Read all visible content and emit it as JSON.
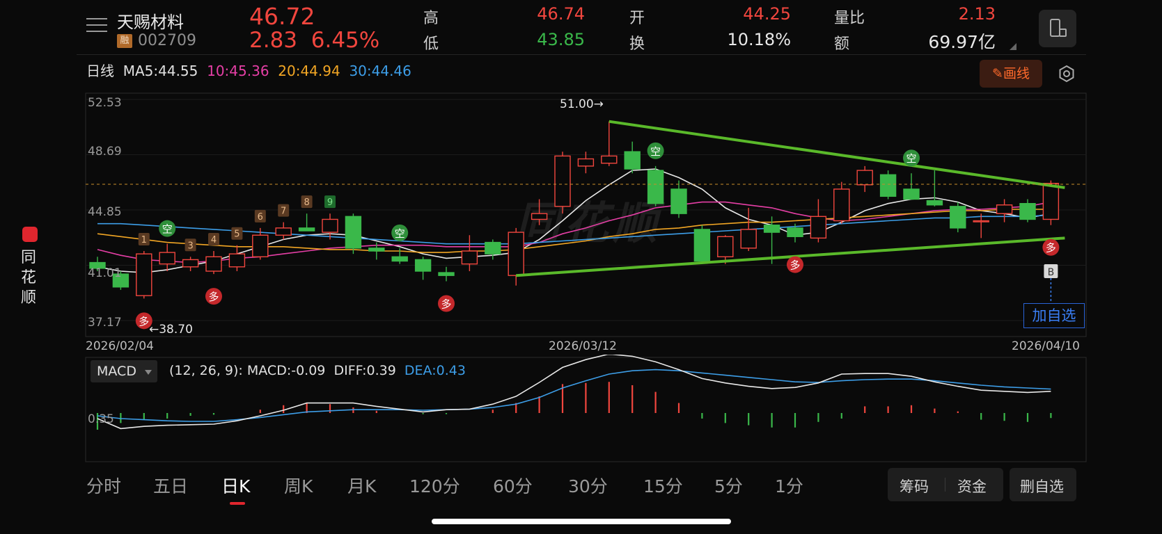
{
  "rail": {
    "brand": "同花顺"
  },
  "stock": {
    "name": "天赐材料",
    "margin_badge": "融",
    "code": "002709",
    "price": "46.72",
    "change": "2.83",
    "change_pct": "6.45%"
  },
  "quote": {
    "high_label": "高",
    "high": "46.74",
    "low_label": "低",
    "low": "43.85",
    "open_label": "开",
    "open": "44.25",
    "turnover_label": "换",
    "turnover": "10.18%",
    "vol_ratio_label": "量比",
    "vol_ratio": "2.13",
    "amount_label": "额",
    "amount": "69.97亿"
  },
  "ma": {
    "period": "日线",
    "ma5": "MA5:44.55",
    "ma10": "10:45.36",
    "ma20": "20:44.94",
    "ma30": "30:44.46"
  },
  "toolbar": {
    "draw_label": "画线"
  },
  "colors": {
    "up": "#f1463e",
    "down": "#3ab84a",
    "ma5": "#e8e8e8",
    "ma10": "#e63fa6",
    "ma20": "#f2a624",
    "ma30": "#3d9ee8",
    "trendline": "#5ab92a"
  },
  "watermark": "同花顺",
  "kline": {
    "y_ticks": [
      "52.53",
      "48.69",
      "44.85",
      "41.01",
      "37.17"
    ],
    "dates": {
      "start": "2026/02/04",
      "mid": "2026/03/12",
      "end": "2026/04/10"
    },
    "max_label": "51.00→",
    "min_label": "←38.70",
    "sell_signal": "空",
    "buy_signal": "多",
    "b_marker": "B",
    "td_counts": [
      "1",
      "3",
      "4",
      "5",
      "6",
      "7",
      "8",
      "9"
    ]
  },
  "add_fav": "加自选",
  "macd": {
    "indicator": "MACD",
    "params": "(12, 26, 9):",
    "macd": "MACD:-0.09",
    "diff": "DIFF:0.39",
    "dea": "DEA:0.43",
    "y_tick": "0.35"
  },
  "tabs": [
    {
      "label": "分时"
    },
    {
      "label": "五日"
    },
    {
      "label": "日K"
    },
    {
      "label": "周K"
    },
    {
      "label": "月K"
    },
    {
      "label": "120分"
    },
    {
      "label": "60分"
    },
    {
      "label": "30分"
    },
    {
      "label": "15分"
    },
    {
      "label": "5分"
    },
    {
      "label": "1分"
    }
  ],
  "buttons": {
    "chips": "筹码",
    "funds": "资金",
    "remove_fav": "删自选"
  },
  "chart_data": {
    "type": "candlestick",
    "title": "",
    "ylim": [
      37.17,
      52.53
    ],
    "y_ticks": [
      52.53,
      48.69,
      44.85,
      41.01,
      37.17
    ],
    "x": [
      "2026/02/04",
      "2026/03/12",
      "2026/04/10"
    ],
    "candles": [
      {
        "o": 41.2,
        "h": 41.6,
        "l": 40.6,
        "c": 40.8
      },
      {
        "o": 40.4,
        "h": 40.6,
        "l": 39.3,
        "c": 39.5
      },
      {
        "o": 38.9,
        "h": 42.0,
        "l": 38.7,
        "c": 41.8
      },
      {
        "o": 41.1,
        "h": 42.5,
        "l": 40.6,
        "c": 41.9
      },
      {
        "o": 40.9,
        "h": 41.6,
        "l": 40.6,
        "c": 41.4
      },
      {
        "o": 40.6,
        "h": 42.0,
        "l": 40.4,
        "c": 41.6
      },
      {
        "o": 40.9,
        "h": 42.4,
        "l": 40.6,
        "c": 41.8
      },
      {
        "o": 41.6,
        "h": 43.6,
        "l": 41.4,
        "c": 43.1
      },
      {
        "o": 43.1,
        "h": 44.0,
        "l": 42.8,
        "c": 43.6
      },
      {
        "o": 43.6,
        "h": 44.6,
        "l": 43.4,
        "c": 43.4
      },
      {
        "o": 43.3,
        "h": 44.6,
        "l": 42.8,
        "c": 44.2
      },
      {
        "o": 44.4,
        "h": 44.6,
        "l": 41.8,
        "c": 42.2
      },
      {
        "o": 42.2,
        "h": 42.6,
        "l": 41.4,
        "c": 42.0
      },
      {
        "o": 41.6,
        "h": 42.2,
        "l": 41.1,
        "c": 41.3
      },
      {
        "o": 41.4,
        "h": 41.6,
        "l": 40.0,
        "c": 40.6
      },
      {
        "o": 40.5,
        "h": 40.9,
        "l": 39.9,
        "c": 40.3
      },
      {
        "o": 41.1,
        "h": 43.1,
        "l": 40.6,
        "c": 42.0
      },
      {
        "o": 42.6,
        "h": 42.8,
        "l": 41.4,
        "c": 41.8
      },
      {
        "o": 40.3,
        "h": 43.6,
        "l": 39.6,
        "c": 43.3
      },
      {
        "o": 44.2,
        "h": 45.6,
        "l": 43.8,
        "c": 44.6
      },
      {
        "o": 45.1,
        "h": 48.9,
        "l": 44.6,
        "c": 48.6
      },
      {
        "o": 47.9,
        "h": 48.9,
        "l": 47.4,
        "c": 48.4
      },
      {
        "o": 48.1,
        "h": 51.0,
        "l": 47.9,
        "c": 48.6
      },
      {
        "o": 48.9,
        "h": 49.6,
        "l": 47.4,
        "c": 47.7
      },
      {
        "o": 47.6,
        "h": 47.9,
        "l": 45.1,
        "c": 45.3
      },
      {
        "o": 46.3,
        "h": 46.9,
        "l": 44.3,
        "c": 44.6
      },
      {
        "o": 43.5,
        "h": 43.8,
        "l": 41.1,
        "c": 41.3
      },
      {
        "o": 41.6,
        "h": 43.1,
        "l": 41.1,
        "c": 43.0
      },
      {
        "o": 42.2,
        "h": 45.0,
        "l": 42.0,
        "c": 43.5
      },
      {
        "o": 43.8,
        "h": 44.4,
        "l": 41.1,
        "c": 43.3
      },
      {
        "o": 43.6,
        "h": 43.9,
        "l": 42.6,
        "c": 43.0
      },
      {
        "o": 42.9,
        "h": 45.6,
        "l": 42.6,
        "c": 44.4
      },
      {
        "o": 44.1,
        "h": 46.8,
        "l": 43.9,
        "c": 46.3
      },
      {
        "o": 46.6,
        "h": 47.9,
        "l": 46.1,
        "c": 47.6
      },
      {
        "o": 47.3,
        "h": 47.6,
        "l": 45.6,
        "c": 45.8
      },
      {
        "o": 46.3,
        "h": 47.4,
        "l": 45.6,
        "c": 45.6
      },
      {
        "o": 45.5,
        "h": 47.6,
        "l": 45.1,
        "c": 45.2
      },
      {
        "o": 45.1,
        "h": 45.4,
        "l": 43.3,
        "c": 43.6
      },
      {
        "o": 44.1,
        "h": 44.6,
        "l": 42.9,
        "c": 44.1
      },
      {
        "o": 44.6,
        "h": 45.6,
        "l": 44.0,
        "c": 45.2
      },
      {
        "o": 45.3,
        "h": 45.6,
        "l": 44.0,
        "c": 44.2
      },
      {
        "o": 44.2,
        "h": 46.9,
        "l": 43.8,
        "c": 46.7
      }
    ],
    "series": [
      {
        "name": "MA5",
        "values": [
          40.9,
          40.6,
          40.5,
          40.7,
          41.0,
          41.3,
          41.8,
          42.3,
          42.8,
          43.1,
          43.2,
          43.1,
          42.7,
          42.3,
          41.8,
          41.5,
          41.6,
          41.7,
          41.9,
          42.8,
          44.1,
          45.5,
          46.6,
          47.6,
          47.7,
          47.1,
          46.3,
          45.0,
          44.2,
          43.8,
          43.1,
          43.3,
          44.0,
          44.8,
          45.3,
          45.6,
          45.7,
          45.4,
          44.8,
          44.6,
          44.3,
          44.6
        ]
      },
      {
        "name": "10",
        "values": [
          42.1,
          41.7,
          41.4,
          41.3,
          41.2,
          41.3,
          41.5,
          41.6,
          41.8,
          42.0,
          42.2,
          42.3,
          42.4,
          42.4,
          42.4,
          42.3,
          42.3,
          42.3,
          42.3,
          42.6,
          43.2,
          43.6,
          44.1,
          44.5,
          45.0,
          45.2,
          45.4,
          45.4,
          45.2,
          45.0,
          44.6,
          44.3,
          44.1,
          44.2,
          44.4,
          44.6,
          44.8,
          44.9,
          44.9,
          45.0,
          45.1,
          45.4
        ]
      },
      {
        "name": "20",
        "values": [
          43.2,
          43.0,
          42.8,
          42.6,
          42.5,
          42.4,
          42.3,
          42.3,
          42.3,
          42.2,
          42.1,
          42.1,
          42.0,
          42.0,
          41.9,
          41.9,
          42.0,
          42.0,
          42.1,
          42.3,
          42.5,
          42.7,
          43.0,
          43.2,
          43.5,
          43.6,
          43.8,
          43.9,
          44.0,
          44.0,
          44.1,
          44.2,
          44.3,
          44.4,
          44.5,
          44.6,
          44.7,
          44.8,
          44.8,
          44.9,
          44.9,
          44.9
        ]
      },
      {
        "name": "30",
        "values": [
          43.9,
          43.9,
          43.8,
          43.7,
          43.6,
          43.5,
          43.4,
          43.3,
          43.2,
          43.1,
          43.0,
          42.9,
          42.8,
          42.7,
          42.6,
          42.5,
          42.5,
          42.5,
          42.5,
          42.6,
          42.7,
          42.8,
          42.9,
          43.0,
          43.1,
          43.2,
          43.3,
          43.4,
          43.5,
          43.6,
          43.7,
          43.8,
          43.9,
          44.0,
          44.1,
          44.2,
          44.3,
          44.3,
          44.4,
          44.4,
          44.4,
          44.5
        ]
      }
    ],
    "trendlines": [
      {
        "from": {
          "i": 22,
          "v": 51.0
        },
        "to": {
          "i": 41,
          "v": 46.4
        }
      },
      {
        "from": {
          "i": 18,
          "v": 40.3
        },
        "to": {
          "i": 41,
          "v": 42.9
        }
      }
    ],
    "signals": [
      {
        "i": 2,
        "type": "buy"
      },
      {
        "i": 3,
        "type": "sell"
      },
      {
        "i": 5,
        "type": "buy"
      },
      {
        "i": 13,
        "type": "sell"
      },
      {
        "i": 15,
        "type": "buy"
      },
      {
        "i": 24,
        "type": "sell"
      },
      {
        "i": 30,
        "type": "buy"
      },
      {
        "i": 35,
        "type": "sell"
      },
      {
        "i": 41,
        "type": "buy"
      }
    ],
    "td_labels": [
      {
        "i": 2,
        "n": "1"
      },
      {
        "i": 4,
        "n": "3"
      },
      {
        "i": 5,
        "n": "4"
      },
      {
        "i": 6,
        "n": "5"
      },
      {
        "i": 7,
        "n": "6"
      },
      {
        "i": 8,
        "n": "7"
      },
      {
        "i": 9,
        "n": "8"
      },
      {
        "i": 10,
        "n": "9"
      }
    ],
    "macd": {
      "ylim": [
        -0.45,
        1.25
      ],
      "y_tick": 0.35,
      "hist": [
        -0.3,
        -0.18,
        -0.12,
        -0.1,
        -0.05,
        -0.03,
        0.0,
        0.06,
        0.14,
        0.18,
        0.16,
        0.1,
        0.04,
        0.0,
        -0.02,
        -0.02,
        0.0,
        0.06,
        0.18,
        0.3,
        0.52,
        0.54,
        0.56,
        0.5,
        0.38,
        0.18,
        -0.1,
        -0.18,
        -0.22,
        -0.26,
        -0.26,
        -0.16,
        -0.1,
        0.12,
        0.12,
        0.14,
        0.08,
        0.03,
        -0.12,
        -0.14,
        -0.16,
        -0.09
      ],
      "diff": [
        -0.1,
        -0.28,
        -0.24,
        -0.22,
        -0.21,
        -0.2,
        -0.14,
        -0.05,
        0.05,
        0.18,
        0.18,
        0.18,
        0.12,
        0.07,
        0.02,
        0.06,
        0.07,
        0.16,
        0.3,
        0.55,
        0.82,
        0.96,
        1.06,
        1.02,
        0.92,
        0.78,
        0.62,
        0.54,
        0.48,
        0.44,
        0.46,
        0.54,
        0.7,
        0.71,
        0.71,
        0.66,
        0.56,
        0.48,
        0.41,
        0.39,
        0.37,
        0.39
      ],
      "dea": [
        -0.05,
        -0.1,
        -0.12,
        -0.14,
        -0.15,
        -0.15,
        -0.12,
        -0.08,
        -0.03,
        0.02,
        0.04,
        0.06,
        0.06,
        0.06,
        0.05,
        0.06,
        0.07,
        0.1,
        0.16,
        0.28,
        0.45,
        0.58,
        0.7,
        0.76,
        0.78,
        0.76,
        0.72,
        0.68,
        0.64,
        0.6,
        0.56,
        0.55,
        0.58,
        0.6,
        0.61,
        0.61,
        0.58,
        0.54,
        0.5,
        0.47,
        0.45,
        0.43
      ]
    }
  }
}
